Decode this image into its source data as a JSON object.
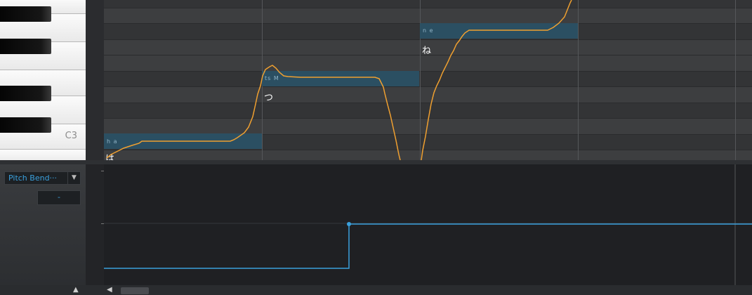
{
  "piano": {
    "c3_label": "C3"
  },
  "notes": [
    {
      "phoneme": "h a",
      "lyric": "は"
    },
    {
      "phoneme": "ts M",
      "lyric": "つ"
    },
    {
      "phoneme": "n e",
      "lyric": "ね"
    }
  ],
  "controller": {
    "parameter": "Pitch Bend···",
    "value": "-"
  },
  "colors": {
    "pitch_curve": "#f0a030",
    "note_fill": "#2b5165",
    "automation_line": "#3aa0dd",
    "accent_text": "#3aa0dd"
  }
}
